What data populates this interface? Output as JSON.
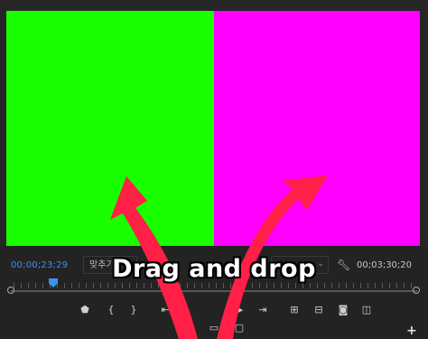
{
  "program_monitor": {
    "clip_colors": {
      "left": "#19ff00",
      "right": "#ff00ff"
    }
  },
  "controls": {
    "timecode_left": "00;00;23;29",
    "fit_label": "맞추기",
    "timecode_right": "00;03;30;20",
    "accent_color": "#3b93ee",
    "buttons_row1": [
      {
        "icon": "marker-icon",
        "glyph": "⬟"
      },
      {
        "icon": "mark-in-icon",
        "glyph": "{"
      },
      {
        "icon": "mark-out-icon",
        "glyph": "}"
      },
      {
        "icon": "go-to-in-icon",
        "glyph": "⇤"
      },
      {
        "icon": "step-back-icon",
        "glyph": "◂"
      },
      {
        "icon": "play-icon",
        "glyph": "▶"
      },
      {
        "icon": "step-forward-icon",
        "glyph": "▸"
      },
      {
        "icon": "go-to-out-icon",
        "glyph": "⇥"
      },
      {
        "icon": "lift-icon",
        "glyph": "⊞"
      },
      {
        "icon": "extract-icon",
        "glyph": "⊟"
      },
      {
        "icon": "export-frame-icon",
        "glyph": "◙"
      },
      {
        "icon": "comparison-view-icon",
        "glyph": "◫"
      }
    ],
    "buttons_row2": [
      {
        "icon": "multi-camera-icon",
        "glyph": "▭"
      },
      {
        "icon": "safe-margins-icon",
        "glyph": "▢"
      }
    ]
  },
  "overlay": {
    "caption": "Drag and drop",
    "arrow_color": "#ff1f47"
  }
}
